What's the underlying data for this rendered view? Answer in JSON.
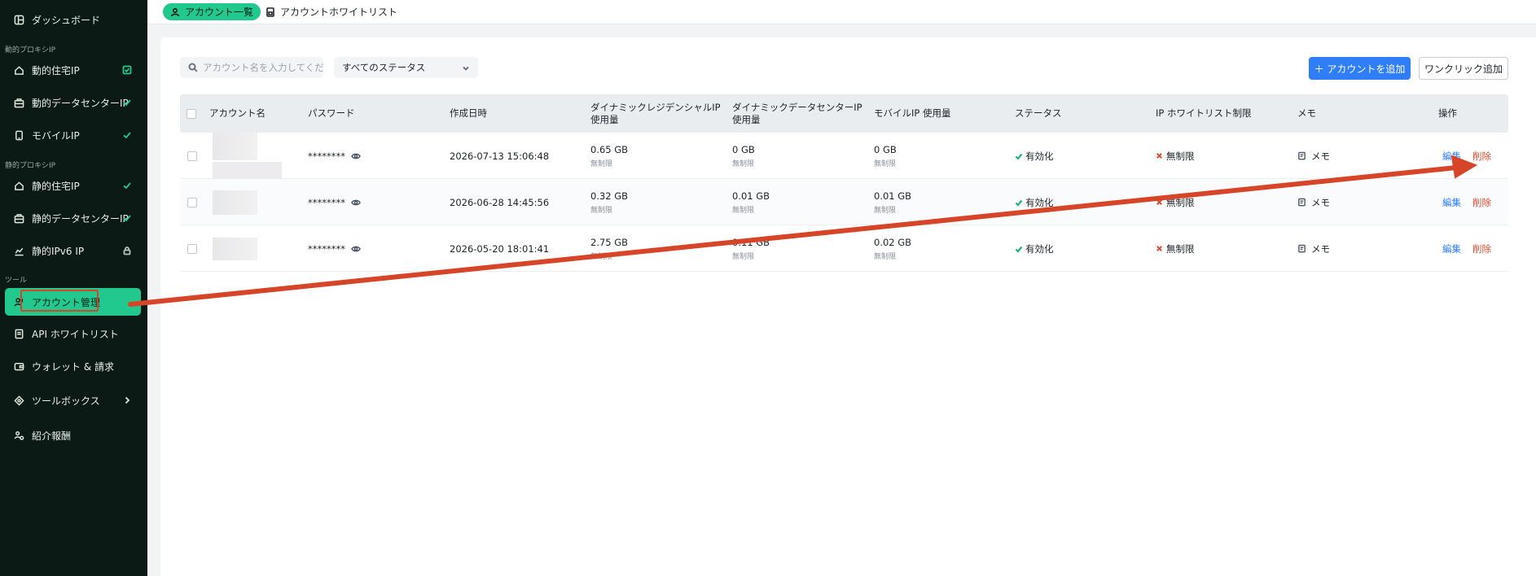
{
  "sidebar": {
    "dashboard": "ダッシュボード",
    "section_dynamic": "動的プロキシIP",
    "dynamic_residential": "動的住宅IP",
    "dynamic_datacenter": "動的データセンターIP",
    "mobile": "モバイルIP",
    "section_static": "静的プロキシIP",
    "static_residential": "静的住宅IP",
    "static_datacenter": "静的データセンターIP",
    "static_ipv6": "静的IPv6 IP",
    "section_tools": "ツール",
    "account_management": "アカウント管理",
    "api_whitelist": "API ホワイトリスト",
    "wallet": "ウォレット & 請求",
    "toolbox": "ツールボックス",
    "referral": "紹介報酬"
  },
  "tabs": {
    "account_list": "アカウント一覧",
    "account_whitelist": "アカウントホワイトリスト"
  },
  "toolbar": {
    "search_placeholder": "アカウント名を入力してください",
    "status_filter": "すべてのステータス",
    "add_account": "＋ アカウントを追加",
    "one_click_add": "ワンクリック追加"
  },
  "table": {
    "headers": {
      "account_name": "アカウント名",
      "password": "パスワード",
      "created": "作成日時",
      "dyn_res_1": "ダイナミックレジデンシャルIP",
      "dyn_res_2": "使用量",
      "dyn_dc_1": "ダイナミックデータセンターIP",
      "dyn_dc_2": "使用量",
      "mobile": "モバイルIP 使用量",
      "status": "ステータス",
      "ip_whitelist": "IP ホワイトリスト制限",
      "memo": "メモ",
      "actions": "操作"
    },
    "rows": [
      {
        "password": "********",
        "created": "2026-07-13 15:06:48",
        "dyn_res": "0.65 GB",
        "dyn_res_limit": "無制限",
        "dyn_dc": "0 GB",
        "dyn_dc_limit": "無制限",
        "mobile": "0 GB",
        "mobile_limit": "無制限",
        "status": "有効化",
        "whitelist": "無制限",
        "memo": "メモ",
        "edit": "編集",
        "delete": "削除"
      },
      {
        "password": "********",
        "created": "2026-06-28 14:45:56",
        "dyn_res": "0.32 GB",
        "dyn_res_limit": "無制限",
        "dyn_dc": "0.01 GB",
        "dyn_dc_limit": "無制限",
        "mobile": "0.01 GB",
        "mobile_limit": "無制限",
        "status": "有効化",
        "whitelist": "無制限",
        "memo": "メモ",
        "edit": "編集",
        "delete": "削除"
      },
      {
        "password": "********",
        "created": "2026-05-20 18:01:41",
        "dyn_res": "2.75 GB",
        "dyn_res_limit": "無制限",
        "dyn_dc": "0.11 GB",
        "dyn_dc_limit": "無制限",
        "mobile": "0.02 GB",
        "mobile_limit": "無制限",
        "status": "有効化",
        "whitelist": "無制限",
        "memo": "メモ",
        "edit": "編集",
        "delete": "削除"
      }
    ]
  },
  "colors": {
    "accent": "#22c98f",
    "primary": "#2f7ef7",
    "danger": "#e0492f",
    "annotation": "#d64528"
  }
}
